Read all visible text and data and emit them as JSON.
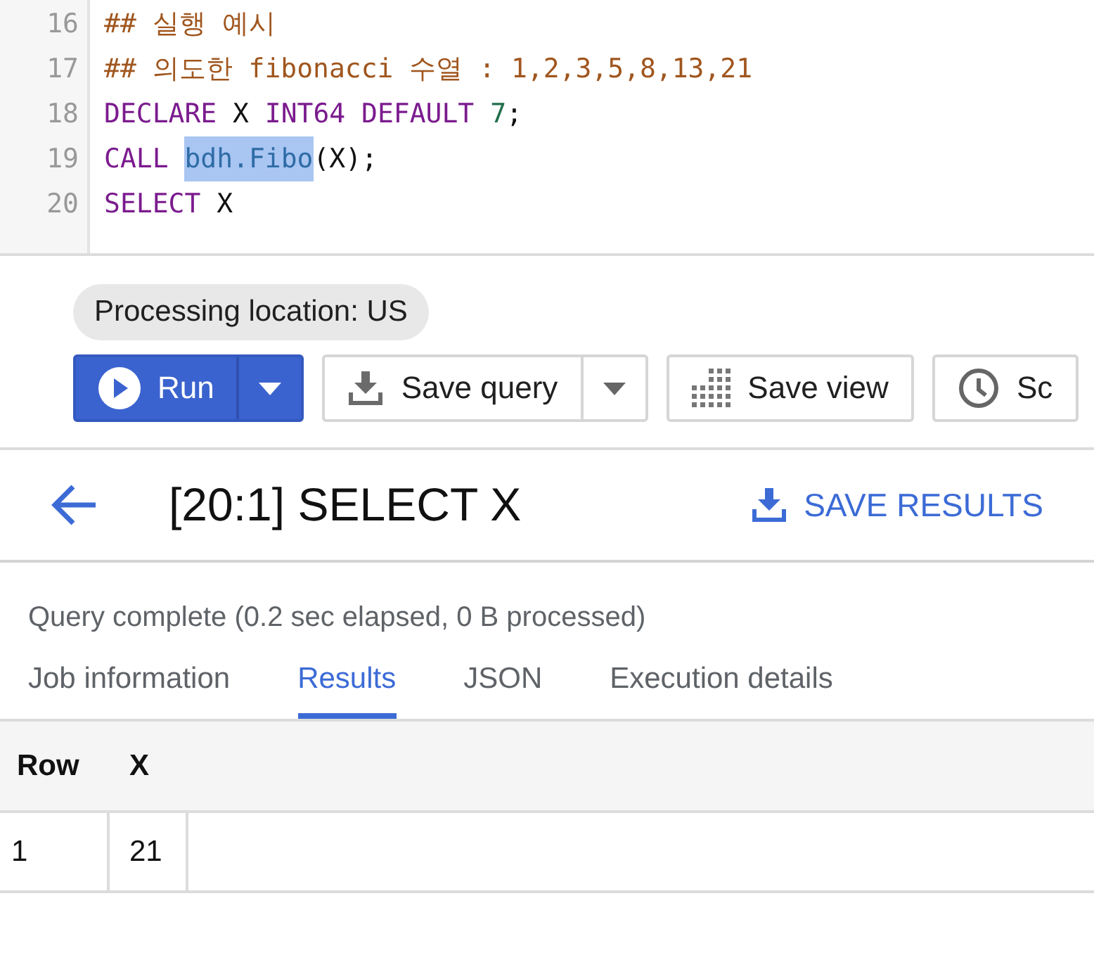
{
  "editor": {
    "lines": [
      {
        "number": "16",
        "tokens": [
          {
            "text": "## 실행 예시",
            "kind": "comment",
            "selected": false
          }
        ]
      },
      {
        "number": "17",
        "tokens": [
          {
            "text": "## 의도한 fibonacci 수열 : 1,2,3,5,8,13,21",
            "kind": "comment",
            "selected": false
          }
        ]
      },
      {
        "number": "18",
        "tokens": [
          {
            "text": "DECLARE",
            "kind": "keyword",
            "selected": false
          },
          {
            "text": " X ",
            "kind": "plain",
            "selected": false
          },
          {
            "text": "INT64 DEFAULT",
            "kind": "keyword",
            "selected": false
          },
          {
            "text": " 7",
            "kind": "number",
            "selected": false
          },
          {
            "text": ";",
            "kind": "plain",
            "selected": false
          }
        ]
      },
      {
        "number": "19",
        "tokens": [
          {
            "text": "CALL ",
            "kind": "keyword",
            "selected": false
          },
          {
            "text": "bdh.Fibo",
            "kind": "identifier",
            "selected": true
          },
          {
            "text": "(X);",
            "kind": "plain",
            "selected": false
          }
        ]
      },
      {
        "number": "20",
        "tokens": [
          {
            "text": "SELECT",
            "kind": "keyword",
            "selected": false
          },
          {
            "text": " X",
            "kind": "plain",
            "selected": false
          }
        ]
      }
    ]
  },
  "processing_location": "Processing location: US",
  "toolbar": [
    {
      "label": "Run",
      "kind": "primary-split"
    },
    {
      "label": "Save query",
      "kind": "split"
    },
    {
      "label": "Save view",
      "kind": "view"
    },
    {
      "label": "Sc",
      "kind": "schedule"
    }
  ],
  "results": {
    "title": "[20:1] SELECT X",
    "save_label": "SAVE RESULTS",
    "status": "Query complete (0.2 sec elapsed, 0 B processed)",
    "tabs": [
      {
        "label": "Job information",
        "selected": false
      },
      {
        "label": "Results",
        "selected": true
      },
      {
        "label": "JSON",
        "selected": false
      },
      {
        "label": "Execution details",
        "selected": false
      }
    ],
    "table": {
      "columns": [
        "Row",
        "X"
      ],
      "rows": [
        [
          "1",
          "21"
        ]
      ]
    }
  }
}
